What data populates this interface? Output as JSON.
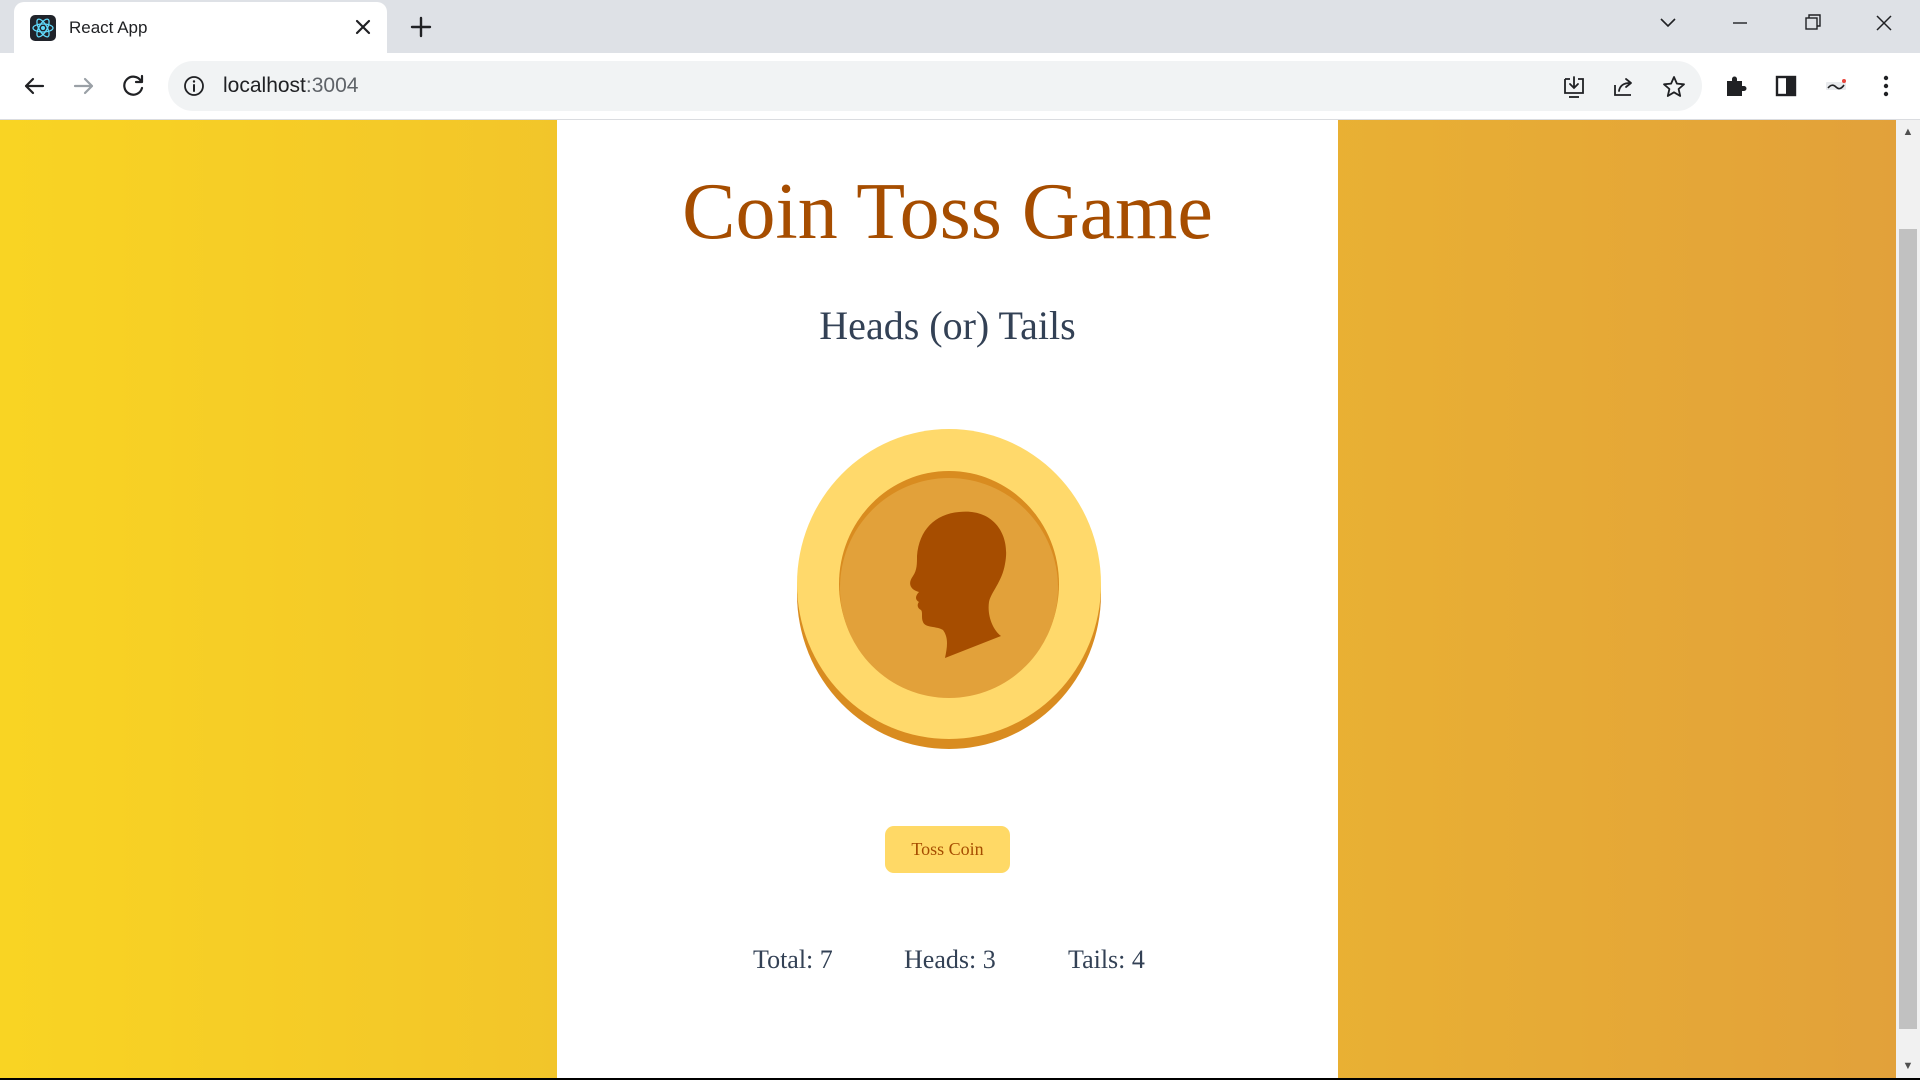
{
  "browser": {
    "tab_title": "React App",
    "new_tab_label": "+",
    "url_host": "localhost",
    "url_port": ":3004"
  },
  "game": {
    "title": "Coin Toss Game",
    "subtitle": "Heads (or) Tails",
    "coin_face": "heads",
    "toss_button_label": "Toss Coin",
    "stats": {
      "total_label": "Total: 7",
      "heads_label": "Heads: 3",
      "tails_label": "Tails: 4"
    }
  },
  "colors": {
    "title": "#a64d00",
    "text": "#334155",
    "button_bg": "#ffd966",
    "gradient_start": "#f9d423",
    "gradient_end": "#e2a13a",
    "coin_outer": "#ffd96b",
    "coin_inner": "#e2a13a",
    "coin_rim": "#d98c20"
  }
}
